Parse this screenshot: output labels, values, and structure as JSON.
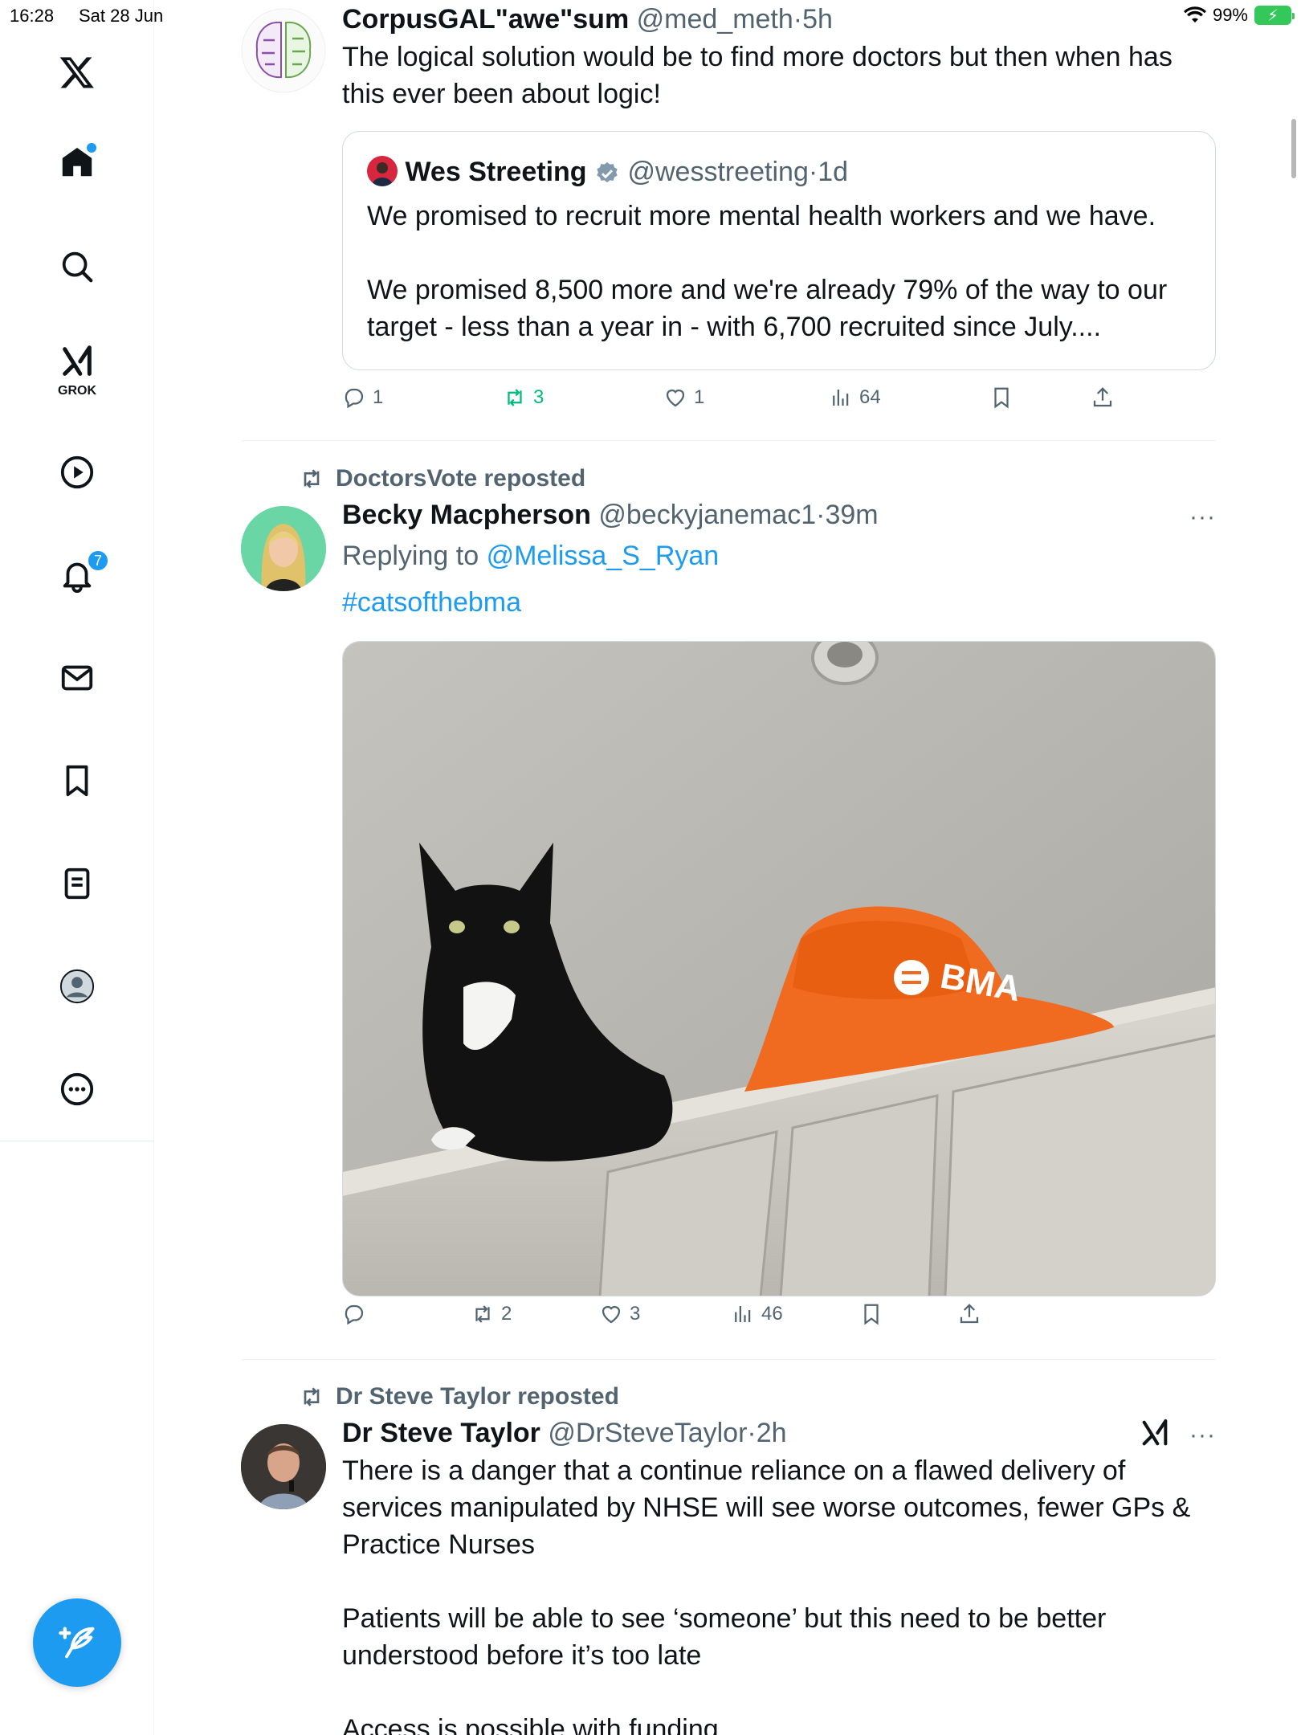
{
  "status": {
    "time": "16:28",
    "date": "Sat 28 Jun",
    "battery": "99%"
  },
  "nav": {
    "grok_label": "GROK",
    "notifications_count": "7"
  },
  "tweets": [
    {
      "name": "CorpusGAL\"awe\"sum",
      "handle": "@med_meth",
      "sep": "·",
      "time": "5h",
      "text": "The logical solution would be to find more doctors but then when has this ever been about logic!",
      "quote": {
        "name": "Wes Streeting",
        "handle": "@wesstreeting",
        "time": "1d",
        "para1": "We promised to recruit more mental health workers and we have.",
        "para2": "We promised 8,500 more and we're already 79% of the way to our target - less than a year in - with 6,700 recruited since July...."
      },
      "actions": {
        "replies": "1",
        "reposts": "3",
        "likes": "1",
        "views": "64"
      }
    },
    {
      "reposted_by": "DoctorsVote reposted",
      "name": "Becky Macpherson",
      "handle": "@beckyjanemac1",
      "sep": "·",
      "time": "39m",
      "replying_prefix": "Replying to",
      "replying_to": "@Melissa_S_Ryan",
      "hashtag": "#catsofthebma",
      "media_text": "BMA",
      "actions": {
        "replies": "",
        "reposts": "2",
        "likes": "3",
        "views": "46"
      }
    },
    {
      "reposted_by": "Dr Steve Taylor reposted",
      "name": "Dr Steve Taylor",
      "handle": "@DrSteveTaylor",
      "sep": "·",
      "time": "2h",
      "para1": "There is a danger that a continue reliance on a flawed delivery of services manipulated by NHSE will see worse outcomes, fewer GPs & Practice Nurses",
      "para2": "Patients will be able to see ‘someone’ but this need to be better understood before it’s too late",
      "para3": "Access is possible with funding"
    }
  ]
}
